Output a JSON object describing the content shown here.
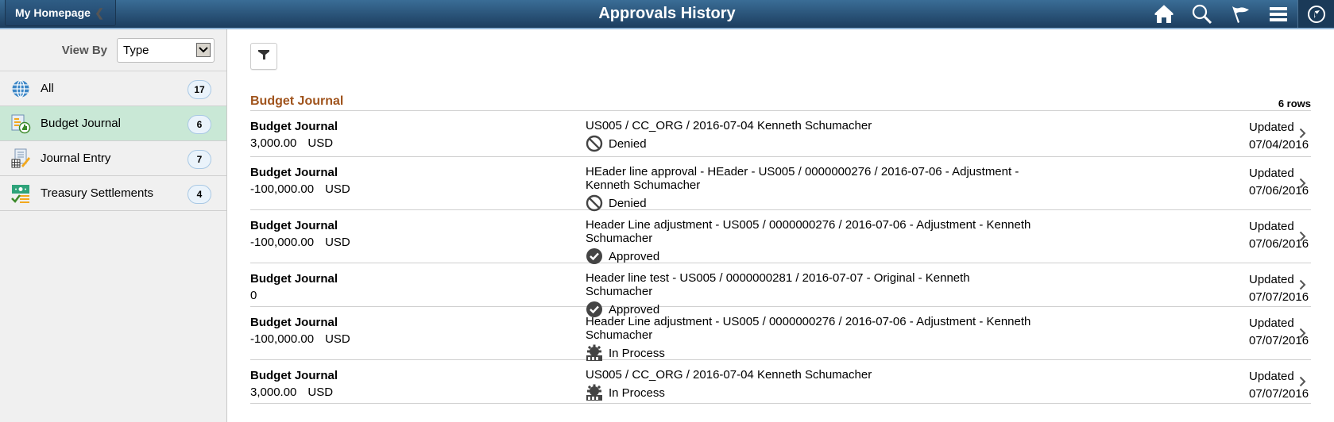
{
  "header": {
    "back_label": "My Homepage",
    "title": "Approvals History",
    "icons": [
      "home-icon",
      "search-icon",
      "flag-icon",
      "menu-icon",
      "navbar-compass-icon"
    ]
  },
  "sidebar": {
    "view_by_label": "View By",
    "view_by_value": "Type",
    "items": [
      {
        "label": "All",
        "count": "17",
        "icon": "globe-icon",
        "selected": false
      },
      {
        "label": "Budget Journal",
        "count": "6",
        "icon": "budget-journal-icon",
        "selected": true
      },
      {
        "label": "Journal Entry",
        "count": "7",
        "icon": "journal-entry-icon",
        "selected": false
      },
      {
        "label": "Treasury Settlements",
        "count": "4",
        "icon": "treasury-settlements-icon",
        "selected": false
      }
    ]
  },
  "main": {
    "section_title": "Budget Journal",
    "row_count": "6 rows",
    "rows": [
      {
        "type": "Budget Journal",
        "amount": "3,000.00",
        "currency": "USD",
        "description": "US005 / CC_ORG / 2016-07-04  Kenneth Schumacher",
        "status": "Denied",
        "status_icon": "denied",
        "updated_label": "Updated",
        "date": "07/04/2016"
      },
      {
        "type": "Budget Journal",
        "amount": "-100,000.00",
        "currency": "USD",
        "description": "HEader line approval - HEader - US005 / 0000000276 / 2016-07-06 - Adjustment - Kenneth Schumacher",
        "status": "Denied",
        "status_icon": "denied",
        "updated_label": "Updated",
        "date": "07/06/2016"
      },
      {
        "type": "Budget Journal",
        "amount": "-100,000.00",
        "currency": "USD",
        "description": "Header Line adjustment - US005 / 0000000276 / 2016-07-06 - Adjustment - Kenneth Schumacher",
        "status": "Approved",
        "status_icon": "approved",
        "updated_label": "Updated",
        "date": "07/06/2016"
      },
      {
        "type": "Budget Journal",
        "amount": "0",
        "currency": "",
        "description": "Header line test - US005 / 0000000281 / 2016-07-07 - Original - Kenneth Schumacher",
        "status": "Approved",
        "status_icon": "approved",
        "updated_label": "Updated",
        "date": "07/07/2016"
      },
      {
        "type": "Budget Journal",
        "amount": "-100,000.00",
        "currency": "USD",
        "description": "Header Line adjustment - US005 / 0000000276 / 2016-07-06 - Adjustment - Kenneth Schumacher",
        "status": "In Process",
        "status_icon": "in-process",
        "updated_label": "Updated",
        "date": "07/07/2016"
      },
      {
        "type": "Budget Journal",
        "amount": "3,000.00",
        "currency": "USD",
        "description": "US005 / CC_ORG / 2016-07-04  Kenneth Schumacher",
        "status": "In Process",
        "status_icon": "in-process",
        "updated_label": "Updated",
        "date": "07/07/2016"
      }
    ]
  },
  "colors": {
    "header_top": "#3a6d96",
    "header_bottom": "#1c3d5e",
    "section_title": "#a0541d",
    "selected_item_bg": "#c9e8d6",
    "sidebar_bg": "#f0f0f0"
  }
}
